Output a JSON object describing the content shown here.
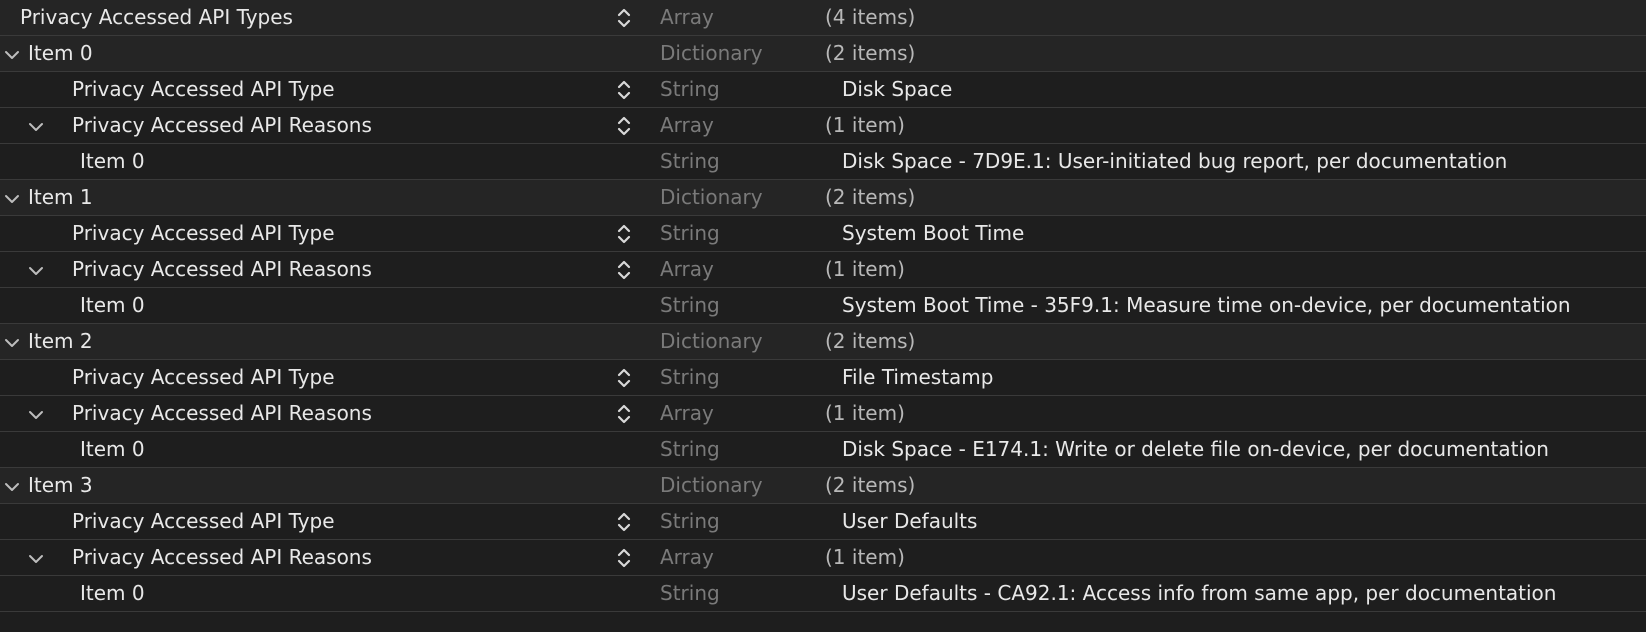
{
  "rows": [
    {
      "key": "Privacy Accessed API Types",
      "type": "Array",
      "value": "(4 items)"
    },
    {
      "key": "Item 0",
      "type": "Dictionary",
      "value": "(2 items)"
    },
    {
      "key": "Privacy Accessed API Type",
      "type": "String",
      "value": "Disk Space"
    },
    {
      "key": "Privacy Accessed API Reasons",
      "type": "Array",
      "value": "(1 item)"
    },
    {
      "key": "Item 0",
      "type": "String",
      "value": "Disk Space - 7D9E.1: User-initiated bug report, per documentation"
    },
    {
      "key": "Item 1",
      "type": "Dictionary",
      "value": "(2 items)"
    },
    {
      "key": "Privacy Accessed API Type",
      "type": "String",
      "value": "System Boot Time"
    },
    {
      "key": "Privacy Accessed API Reasons",
      "type": "Array",
      "value": "(1 item)"
    },
    {
      "key": "Item 0",
      "type": "String",
      "value": "System Boot Time - 35F9.1: Measure time on-device, per documentation"
    },
    {
      "key": "Item 2",
      "type": "Dictionary",
      "value": "(2 items)"
    },
    {
      "key": "Privacy Accessed API Type",
      "type": "String",
      "value": "File Timestamp"
    },
    {
      "key": "Privacy Accessed API Reasons",
      "type": "Array",
      "value": "(1 item)"
    },
    {
      "key": "Item 0",
      "type": "String",
      "value": "Disk Space - E174.1: Write or delete file on-device, per documentation"
    },
    {
      "key": "Item 3",
      "type": "Dictionary",
      "value": "(2 items)"
    },
    {
      "key": "Privacy Accessed API Type",
      "type": "String",
      "value": "User Defaults"
    },
    {
      "key": "Privacy Accessed API Reasons",
      "type": "Array",
      "value": "(1 item)"
    },
    {
      "key": "Item 0",
      "type": "String",
      "value": "User Defaults - CA92.1: Access info from same app, per documentation"
    }
  ],
  "icons": {
    "disclosure": "chevron-down-icon",
    "type_selector": "up-down-stepper-icon"
  }
}
